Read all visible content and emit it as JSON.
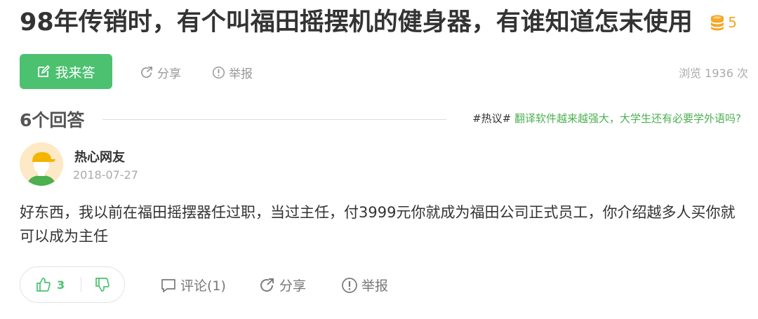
{
  "question": {
    "title": "98年传销时，有个叫福田摇摆机的健身器，有谁知道怎末使用",
    "reward": "5",
    "reward_icon": "coin-stack-icon"
  },
  "actions": {
    "answer_label": "我来答",
    "share_label": "分享",
    "report_label": "举报",
    "views": "浏览 1936 次"
  },
  "answers_header": {
    "count_label": "6个回答",
    "hot_tag": "#热议#",
    "hot_text": "翻译软件越来越强大，大学生还有必要学外语吗?"
  },
  "answer": {
    "user": "热心网友",
    "date": "2018-07-27",
    "text": "好东西，我以前在福田摇摆器任过职，当过主任，付3999元你就成为福田公司正式员工，你介绍越多人买你就可以成为主任",
    "upvotes": "3",
    "comment_label": "评论(1)",
    "share_label": "分享",
    "report_label": "举报"
  },
  "colors": {
    "brand_green": "#4cc170",
    "reward_gold": "#f5a623",
    "muted": "#999999"
  }
}
